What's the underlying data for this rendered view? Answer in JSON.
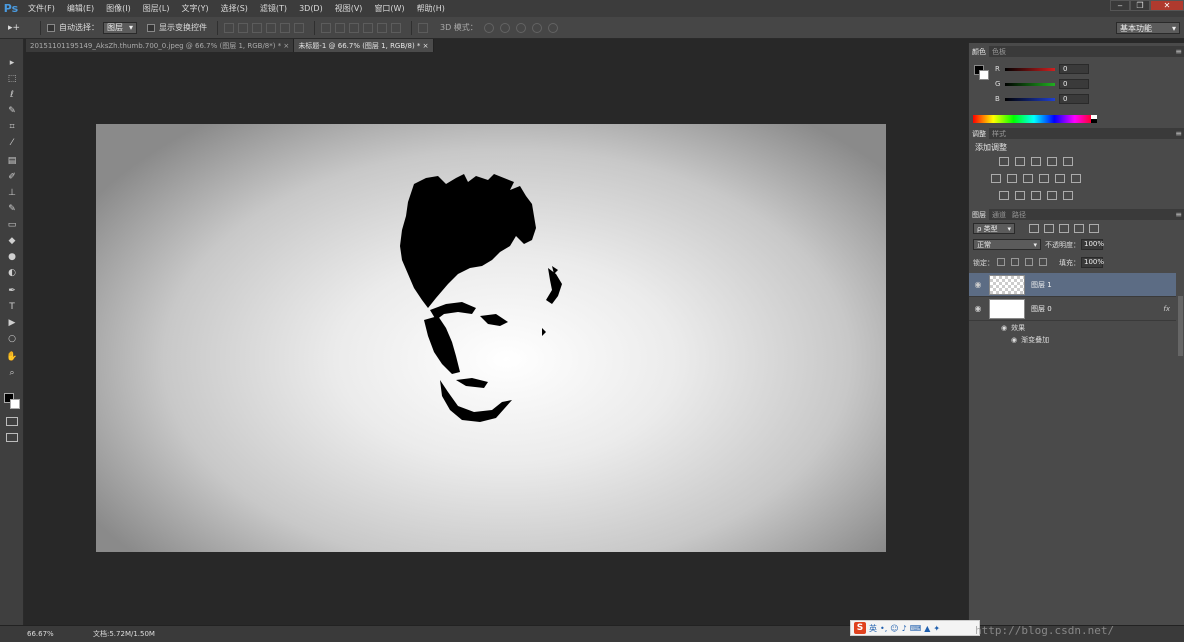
{
  "app": {
    "logo": "Ps",
    "menu": [
      "文件(F)",
      "编辑(E)",
      "图像(I)",
      "图层(L)",
      "文字(Y)",
      "选择(S)",
      "滤镜(T)",
      "3D(D)",
      "视图(V)",
      "窗口(W)",
      "帮助(H)"
    ],
    "window_controls": [
      "‒",
      "❐",
      "✕"
    ]
  },
  "options": {
    "tool_symbol": "▸+",
    "auto_select_label": "自动选择：",
    "auto_select_value": "图层",
    "show_transform_label": "显示变换控件",
    "mode_3d_label": "3D 模式：",
    "workspace": "基本功能"
  },
  "tabs": [
    {
      "label": "20151101195149_AksZh.thumb.700_0.jpeg @ 66.7% (图层 1, RGB/8*) * ×",
      "active": false
    },
    {
      "label": "未标题-1 @ 66.7% (图层 1, RGB/8) * ×",
      "active": true
    }
  ],
  "toolbar": [
    {
      "name": "move-tool-icon",
      "glyph": "▸"
    },
    {
      "name": "marquee-tool-icon",
      "glyph": "⬚"
    },
    {
      "name": "lasso-tool-icon",
      "glyph": "ℓ"
    },
    {
      "name": "quick-select-tool-icon",
      "glyph": "✎"
    },
    {
      "name": "crop-tool-icon",
      "glyph": "⌗"
    },
    {
      "name": "eyedropper-tool-icon",
      "glyph": "⁄"
    },
    {
      "name": "healing-brush-tool-icon",
      "glyph": "▤"
    },
    {
      "name": "brush-tool-icon",
      "glyph": "✐"
    },
    {
      "name": "clone-stamp-tool-icon",
      "glyph": "⊥"
    },
    {
      "name": "history-brush-tool-icon",
      "glyph": "✎"
    },
    {
      "name": "eraser-tool-icon",
      "glyph": "▭"
    },
    {
      "name": "paint-bucket-tool-icon",
      "glyph": "◆"
    },
    {
      "name": "blur-tool-icon",
      "glyph": "●"
    },
    {
      "name": "dodge-tool-icon",
      "glyph": "◐"
    },
    {
      "name": "pen-tool-icon",
      "glyph": "✒"
    },
    {
      "name": "type-tool-icon",
      "glyph": "T"
    },
    {
      "name": "path-select-tool-icon",
      "glyph": "▶"
    },
    {
      "name": "ellipse-tool-icon",
      "glyph": "○"
    },
    {
      "name": "hand-tool-icon",
      "glyph": "✋"
    },
    {
      "name": "zoom-tool-icon",
      "glyph": "⌕"
    }
  ],
  "color_panel": {
    "tabs": [
      "颜色",
      "色板"
    ],
    "channels": [
      {
        "label": "R",
        "value": "0",
        "color": "#d02020"
      },
      {
        "label": "G",
        "value": "0",
        "color": "#20b020"
      },
      {
        "label": "B",
        "value": "0",
        "color": "#2040d0"
      }
    ]
  },
  "adjust_panel": {
    "tabs": [
      "调整",
      "样式"
    ],
    "title": "添加调整"
  },
  "layers_panel": {
    "tabs": [
      "图层",
      "通道",
      "路径"
    ],
    "filter": "ρ 类型",
    "blend_mode": "正常",
    "opacity_label": "不透明度：",
    "opacity_value": "100%",
    "lock_label": "锁定：",
    "fill_label": "填充：",
    "fill_value": "100%",
    "layers": [
      {
        "name": "图层 1",
        "selected": true
      },
      {
        "name": "图层 0",
        "selected": false,
        "fx": "fx"
      }
    ],
    "effects_label": "效果",
    "effect_item": "渐变叠加"
  },
  "status": {
    "zoom": "66.67%",
    "doc": "文档:5.72M/1.50M"
  },
  "ime": {
    "logo": "S",
    "lang": "英"
  },
  "watermark": "http://blog.csdn.net/"
}
